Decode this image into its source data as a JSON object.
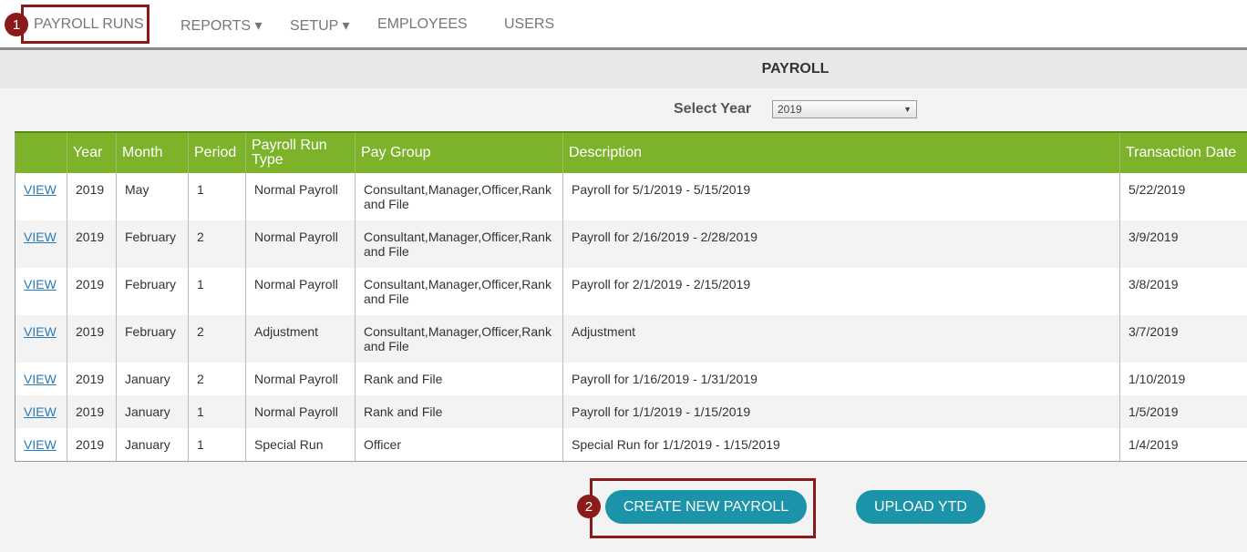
{
  "nav": {
    "items": [
      {
        "label": "PAYROLL RUNS"
      },
      {
        "label": "REPORTS ▾"
      },
      {
        "label": "SETUP ▾"
      },
      {
        "label": "EMPLOYEES"
      },
      {
        "label": "USERS"
      }
    ],
    "callout_1": "1"
  },
  "page": {
    "title": "PAYROLL",
    "year_label": "Select Year",
    "year_value": "2019"
  },
  "table": {
    "headers": [
      "",
      "Year",
      "Month",
      "Period",
      "Payroll Run Type",
      "Pay Group",
      "Description",
      "Transaction Date"
    ],
    "rows": [
      {
        "view": "VIEW",
        "year": "2019",
        "month": "May",
        "period": "1",
        "type": "Normal Payroll",
        "group": "Consultant,Manager,Officer,Rank and File",
        "description": "Payroll for 5/1/2019 - 5/15/2019",
        "date": "5/22/2019"
      },
      {
        "view": "VIEW",
        "year": "2019",
        "month": "February",
        "period": "2",
        "type": "Normal Payroll",
        "group": "Consultant,Manager,Officer,Rank and File",
        "description": "Payroll for 2/16/2019 - 2/28/2019",
        "date": "3/9/2019"
      },
      {
        "view": "VIEW",
        "year": "2019",
        "month": "February",
        "period": "1",
        "type": "Normal Payroll",
        "group": "Consultant,Manager,Officer,Rank and File",
        "description": "Payroll for 2/1/2019 - 2/15/2019",
        "date": "3/8/2019"
      },
      {
        "view": "VIEW",
        "year": "2019",
        "month": "February",
        "period": "2",
        "type": "Adjustment",
        "group": "Consultant,Manager,Officer,Rank and File",
        "description": "Adjustment",
        "date": "3/7/2019"
      },
      {
        "view": "VIEW",
        "year": "2019",
        "month": "January",
        "period": "2",
        "type": "Normal Payroll",
        "group": "Rank and File",
        "description": "Payroll for 1/16/2019 - 1/31/2019",
        "date": "1/10/2019"
      },
      {
        "view": "VIEW",
        "year": "2019",
        "month": "January",
        "period": "1",
        "type": "Normal Payroll",
        "group": "Rank and File",
        "description": "Payroll for 1/1/2019 - 1/15/2019",
        "date": "1/5/2019"
      },
      {
        "view": "VIEW",
        "year": "2019",
        "month": "January",
        "period": "1",
        "type": "Special Run",
        "group": "Officer",
        "description": "Special Run for 1/1/2019 - 1/15/2019",
        "date": "1/4/2019"
      }
    ]
  },
  "actions": {
    "create_label": "CREATE NEW PAYROLL",
    "upload_label": "UPLOAD YTD",
    "callout_2": "2"
  }
}
